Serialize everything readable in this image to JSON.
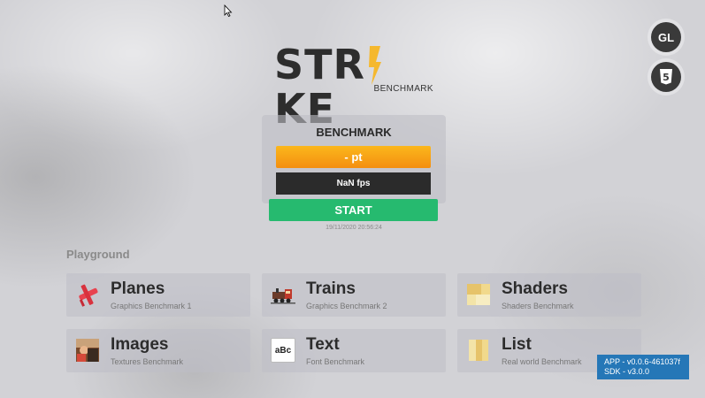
{
  "logo": {
    "title": "STR KE",
    "title_left": "STR",
    "title_right": "KE",
    "subtitle": "BENCHMARK",
    "accent": "#f5b82e"
  },
  "tech_buttons": {
    "gl_label": "GL",
    "html5_label": "5"
  },
  "benchmark": {
    "title": "BENCHMARK",
    "score": "- pt",
    "fps": "NaN fps",
    "start_label": "START",
    "timestamp": "19/11/2020 20:56:24"
  },
  "playground": {
    "heading": "Playground",
    "cards": [
      {
        "title": "Planes",
        "subtitle": "Graphics Benchmark 1",
        "icon": "plane-icon"
      },
      {
        "title": "Trains",
        "subtitle": "Graphics Benchmark 2",
        "icon": "train-icon"
      },
      {
        "title": "Shaders",
        "subtitle": "Shaders Benchmark",
        "icon": "shader-icon"
      },
      {
        "title": "Images",
        "subtitle": "Textures Benchmark",
        "icon": "image-icon"
      },
      {
        "title": "Text",
        "subtitle": "Font Benchmark",
        "icon": "text-icon",
        "icon_text": "aBc"
      },
      {
        "title": "List",
        "subtitle": "Real world Benchmark",
        "icon": "list-icon"
      }
    ]
  },
  "version": {
    "app": "APP - v0.0.6-461037f",
    "sdk": "SDK - v3.0.0"
  },
  "colors": {
    "score_orange": "#f8a316",
    "start_green": "#26ba6f",
    "version_blue": "#2577b7",
    "dark": "#2b2b2b"
  }
}
